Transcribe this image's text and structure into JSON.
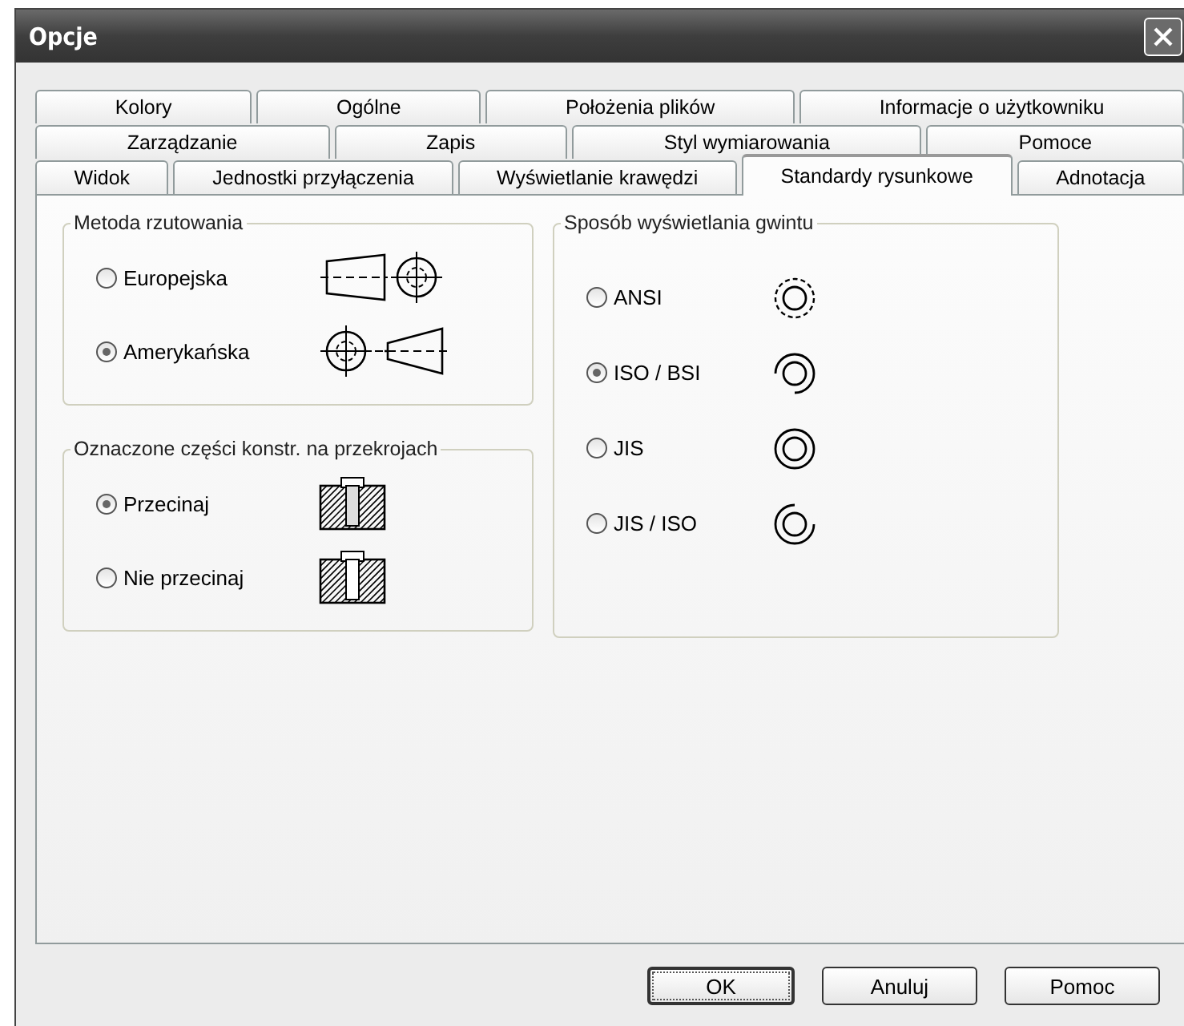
{
  "window": {
    "title": "Opcje"
  },
  "tab_rows": [
    [
      {
        "label": "Kolory",
        "selected": false
      },
      {
        "label": "Ogólne",
        "selected": false
      },
      {
        "label": "Położenia plików",
        "selected": false
      },
      {
        "label": "Informacje o użytkowniku",
        "selected": false
      }
    ],
    [
      {
        "label": "Zarządzanie",
        "selected": false
      },
      {
        "label": "Zapis",
        "selected": false
      },
      {
        "label": "Styl wymiarowania",
        "selected": false
      },
      {
        "label": "Pomoce",
        "selected": false
      }
    ],
    [
      {
        "label": "Widok",
        "selected": false
      },
      {
        "label": "Jednostki przyłączenia",
        "selected": false
      },
      {
        "label": "Wyświetlanie krawędzi",
        "selected": false
      },
      {
        "label": "Standardy rysunkowe",
        "selected": true
      },
      {
        "label": "Adnotacja",
        "selected": false
      }
    ]
  ],
  "projection": {
    "title": "Metoda rzutowania",
    "options": [
      {
        "label": "Europejska",
        "selected": false,
        "kind": "european"
      },
      {
        "label": "Amerykańska",
        "selected": true,
        "kind": "american"
      }
    ]
  },
  "sections": {
    "title": "Oznaczone części konstr. na przekrojach",
    "options": [
      {
        "label": "Przecinaj",
        "selected": true,
        "kind": "cut"
      },
      {
        "label": "Nie przecinaj",
        "selected": false,
        "kind": "uncut"
      }
    ]
  },
  "thread_display": {
    "title": "Sposób wyświetlania gwintu",
    "options": [
      {
        "label": "ANSI",
        "selected": false,
        "kind": "dashed"
      },
      {
        "label": "ISO / BSI",
        "selected": true,
        "kind": "open"
      },
      {
        "label": "JIS",
        "selected": false,
        "kind": "full"
      },
      {
        "label": "JIS / ISO",
        "selected": false,
        "kind": "spiral"
      }
    ]
  },
  "buttons": [
    {
      "label": "OK",
      "kind": "default"
    },
    {
      "label": "Anuluj",
      "kind": "normal"
    },
    {
      "label": "Pomoc",
      "kind": "normal"
    }
  ]
}
